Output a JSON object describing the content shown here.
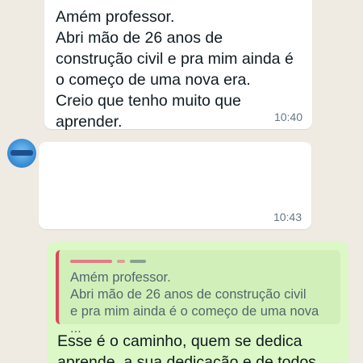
{
  "messages": [
    {
      "text": "Amém professor.\nAbri mão de 26 anos de\nconstrução civil e pra mim ainda é\no começo de uma nova era.\nCreio que tenho muito que\naprender.",
      "time": "10:40"
    },
    {
      "text": "",
      "time": "10:43"
    },
    {
      "quoted": {
        "text": "Amém professor.\nAbri mão de 26 anos de construção civil\ne pra mim ainda é o começo de uma nova ..."
      },
      "text": "Esse é o caminho, quem se dedica\naprende, a sua dedicação e de todos"
    }
  ],
  "colors": {
    "background": "#efeae2",
    "incoming_bubble": "#ffffff",
    "outgoing_bubble": "#dcf8c6",
    "quote_accent": "#e0455a"
  },
  "icons": {
    "avatar": "profile-avatar"
  }
}
